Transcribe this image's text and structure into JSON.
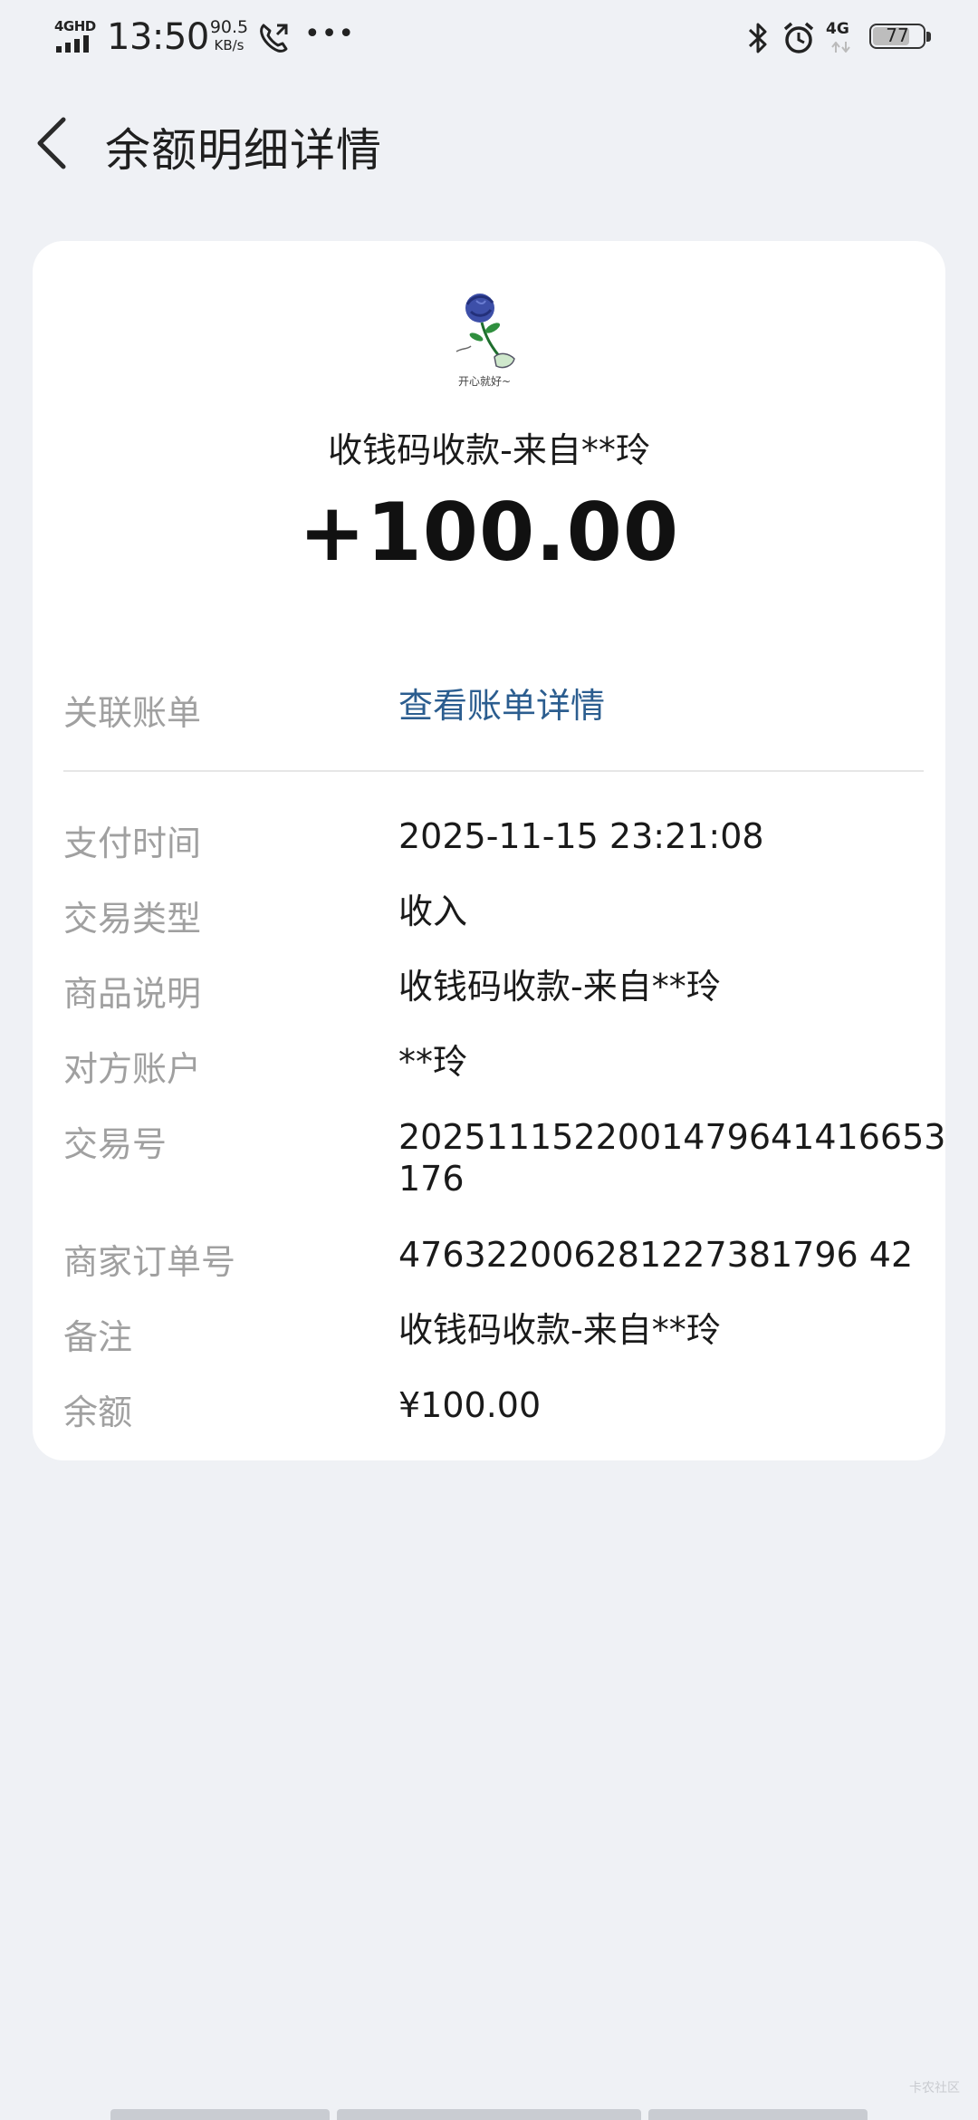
{
  "status_bar": {
    "network_label": "4GHD",
    "time": "13:50",
    "speed_value": "90.5",
    "speed_unit": "KB/s",
    "more_label": "•••",
    "right_network_label": "4G",
    "battery_level": "77"
  },
  "header": {
    "title": "余额明细详情"
  },
  "transaction": {
    "title": "收钱码收款-来自**玲",
    "amount": "+100.00",
    "avatar_caption": "开心就好~"
  },
  "related_bill": {
    "label": "关联账单",
    "link_text": "查看账单详情"
  },
  "details": [
    {
      "label": "支付时间",
      "value": "2025-11-15 23:21:08"
    },
    {
      "label": "交易类型",
      "value": "收入"
    },
    {
      "label": "商品说明",
      "value": "收钱码收款-来自**玲"
    },
    {
      "label": "对方账户",
      "value": "**玲"
    },
    {
      "label": "交易号",
      "value": "2025111522001479641416653176"
    },
    {
      "label": "商家订单号",
      "value": "476322006281227381796 42"
    },
    {
      "label": "备注",
      "value": "收钱码收款-来自**玲"
    },
    {
      "label": "余额",
      "value": "¥100.00"
    }
  ],
  "watermark": "卡农社区",
  "colors": {
    "background": "#eff1f5",
    "card": "#ffffff",
    "label": "#a0a0a0",
    "link": "#2b5d8f",
    "text": "#1a1a1a"
  }
}
